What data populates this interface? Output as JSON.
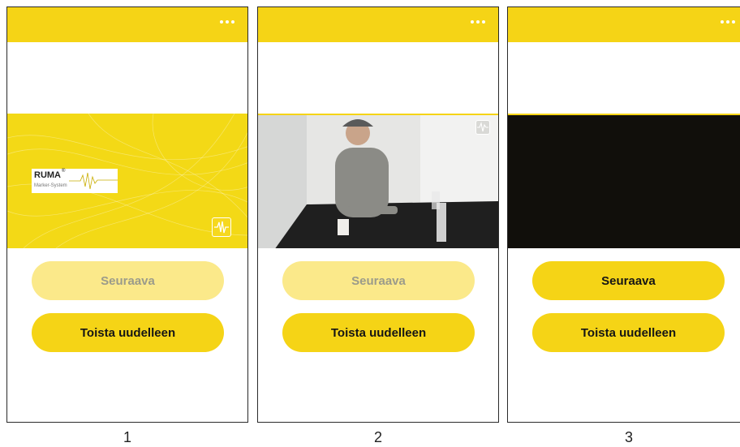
{
  "screens": [
    {
      "caption": "1",
      "next_label": "Seuraava",
      "replay_label": "Toista uudelleen",
      "next_enabled": false,
      "video": {
        "logo_text": "RUMA",
        "logo_sup": "®",
        "logo_subtitle": "Marker-System"
      }
    },
    {
      "caption": "2",
      "next_label": "Seuraava",
      "replay_label": "Toista uudelleen",
      "next_enabled": false,
      "video": {
        "content": "man-at-table"
      }
    },
    {
      "caption": "3",
      "next_label": "Seuraava",
      "replay_label": "Toista uudelleen",
      "next_enabled": true,
      "video": {
        "content": "black"
      }
    }
  ],
  "colors": {
    "accent": "#f5d416",
    "accent_light": "#fbe98a",
    "dark_video": "#110f0b"
  },
  "icons": {
    "menu": "more-horizontal-icon",
    "corner_logo": "ruma-wave-logo-icon"
  }
}
